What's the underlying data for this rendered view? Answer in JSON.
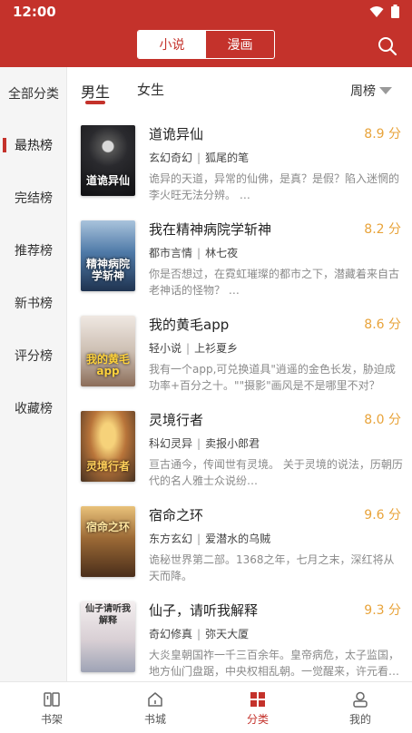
{
  "status": {
    "time": "12:00"
  },
  "header": {
    "tab_novel": "小说",
    "tab_comic": "漫画"
  },
  "sidebar": {
    "items": [
      {
        "label": "全部分类"
      },
      {
        "label": "最热榜"
      },
      {
        "label": "完结榜"
      },
      {
        "label": "推荐榜"
      },
      {
        "label": "新书榜"
      },
      {
        "label": "评分榜"
      },
      {
        "label": "收藏榜"
      }
    ]
  },
  "tabs": {
    "male": "男生",
    "female": "女生",
    "rank_select": "周榜"
  },
  "books": [
    {
      "title": "道诡异仙",
      "score": "8.9 分",
      "genre": "玄幻奇幻",
      "author": "狐尾的笔",
      "desc": "诡异的天道，异常的仙佛，是真？是假？陷入迷惘的李火旺无法分辨。 …",
      "cover_text": "道诡异仙",
      "cover_color": "#2a2a2e"
    },
    {
      "title": "我在精神病院学斩神",
      "score": "8.2 分",
      "genre": "都市言情",
      "author": "林七夜",
      "desc": "你是否想过，在霓虹璀璨的都市之下，潜藏着来自古老神话的怪物？ …",
      "cover_text": "精神病院学斩神",
      "cover_color": "#3a5d86"
    },
    {
      "title": "我的黄毛app",
      "score": "8.6 分",
      "genre": "轻小说",
      "author": "上衫夏乡",
      "desc": "我有一个app,可兑换道具\"逍遥的金色长发，胁迫成功率+百分之十。\"\"摄影\"画风是不是哪里不对？ （ps:…",
      "cover_text": "我的黄毛app",
      "cover_color": "#d8cfc8"
    },
    {
      "title": "灵境行者",
      "score": "8.0 分",
      "genre": "科幻灵异",
      "author": "卖报小郎君",
      "desc": "亘古通今，传闻世有灵境。 关于灵境的说法，历朝历代的名人雅士众说纷…",
      "cover_text": "灵境行者",
      "cover_color": "#3a2a1e"
    },
    {
      "title": "宿命之环",
      "score": "9.6 分",
      "genre": "东方玄幻",
      "author": "爱潜水的乌贼",
      "desc": "诡秘世界第二部。1368之年，七月之末，深红将从天而降。",
      "cover_text": "宿命之环",
      "cover_color": "#5b3b22"
    },
    {
      "title": "仙子，请听我解释",
      "score": "9.3 分",
      "genre": "奇幻修真",
      "author": "弥天大厦",
      "desc": "大炎皇朝国祚一千三百余年。皇帝病危，太子监国，地方仙门盘踞，中央权相乱朝。一觉醒来，许元看…",
      "cover_text": "仙子请听我解释",
      "cover_color": "#e9e2e4"
    }
  ],
  "bottom_nav": [
    {
      "label": "书架",
      "icon": "bookshelf-icon"
    },
    {
      "label": "书城",
      "icon": "home-icon"
    },
    {
      "label": "分类",
      "icon": "category-icon"
    },
    {
      "label": "我的",
      "icon": "profile-icon"
    }
  ],
  "colors": {
    "brand": "#c4322b",
    "score": "#e8a33a"
  }
}
